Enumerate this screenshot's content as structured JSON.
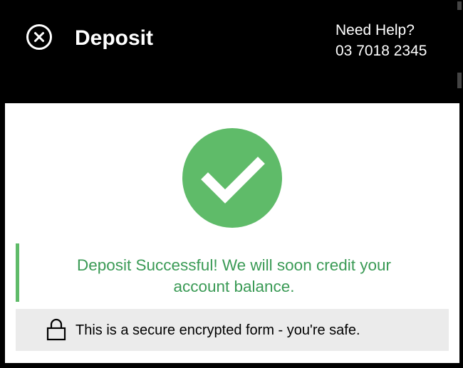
{
  "header": {
    "title": "Deposit",
    "help_label": "Need Help?",
    "help_phone": "03 7018 2345",
    "close_icon": "close-circle-icon"
  },
  "status": {
    "icon": "check-circle-icon",
    "message": "Deposit Successful! We will soon credit your account balance."
  },
  "security": {
    "icon": "lock-icon",
    "text": "This is a secure encrypted form - you're safe."
  },
  "colors": {
    "header_bg": "#000000",
    "success_green": "#5fbb69",
    "success_text": "#3a9a55",
    "secure_bar_bg": "#ebebeb"
  }
}
